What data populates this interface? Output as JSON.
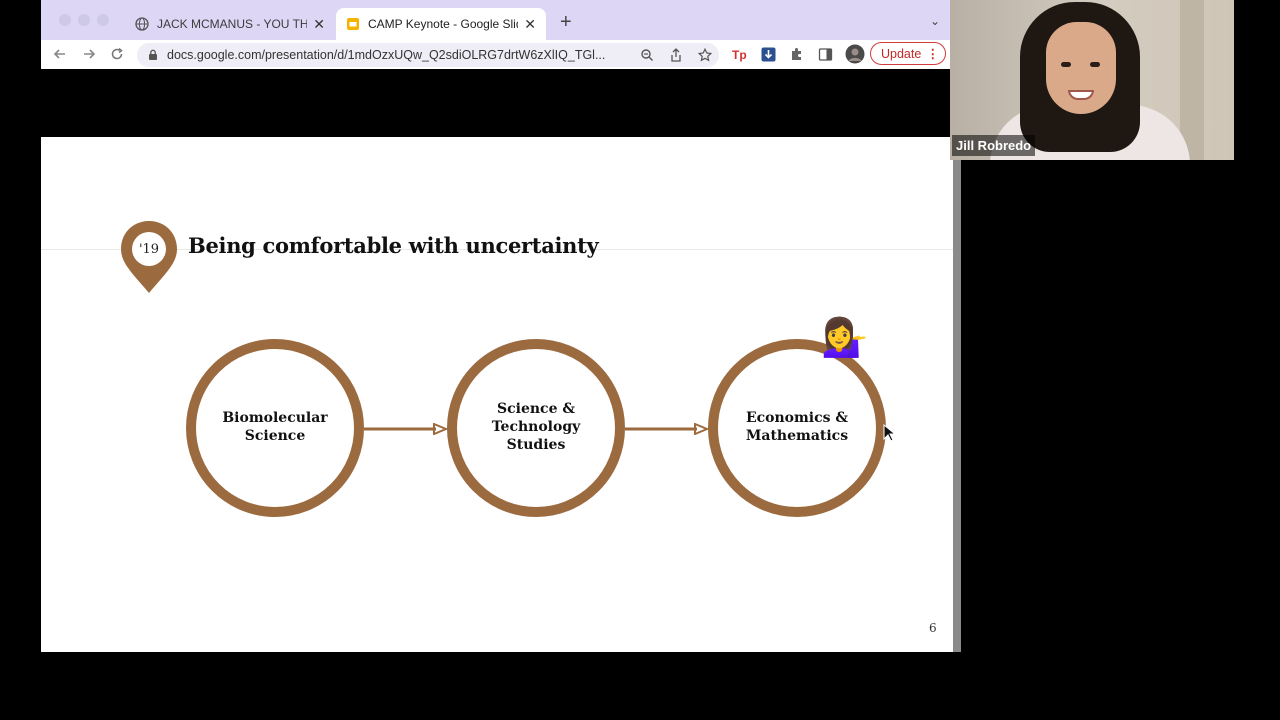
{
  "browser": {
    "tabs": [
      {
        "label": "JACK MCMANUS - YOU THINK",
        "active": false,
        "icon": "globe-icon"
      },
      {
        "label": "CAMP Keynote - Google Slides",
        "active": true,
        "icon": "slides-icon"
      }
    ],
    "close_glyph": "✕",
    "new_tab_glyph": "+",
    "tab_menu_glyph": "⌄",
    "url": "docs.google.com/presentation/d/1mdOzxUQw_Q2sdiOLRG7drtW6zXlIQ_TGl...",
    "update_label": "Update",
    "update_menu_glyph": "⋮",
    "colors": {
      "tabbar": "#ddd7f5",
      "update": "#d23b3b"
    }
  },
  "slide": {
    "year_badge": "'19",
    "title": "Being comfortable with uncertainty",
    "circles": [
      {
        "lines": [
          "Biomolecular",
          "Science"
        ]
      },
      {
        "lines": [
          "Science &",
          "Technology",
          "Studies"
        ]
      },
      {
        "lines": [
          "Economics &",
          "Mathematics"
        ]
      }
    ],
    "emoji": "💁‍♀️",
    "page_number": "6",
    "accent_color": "#9b6a3f"
  },
  "video": {
    "participant_name": "Jill Robredo"
  }
}
